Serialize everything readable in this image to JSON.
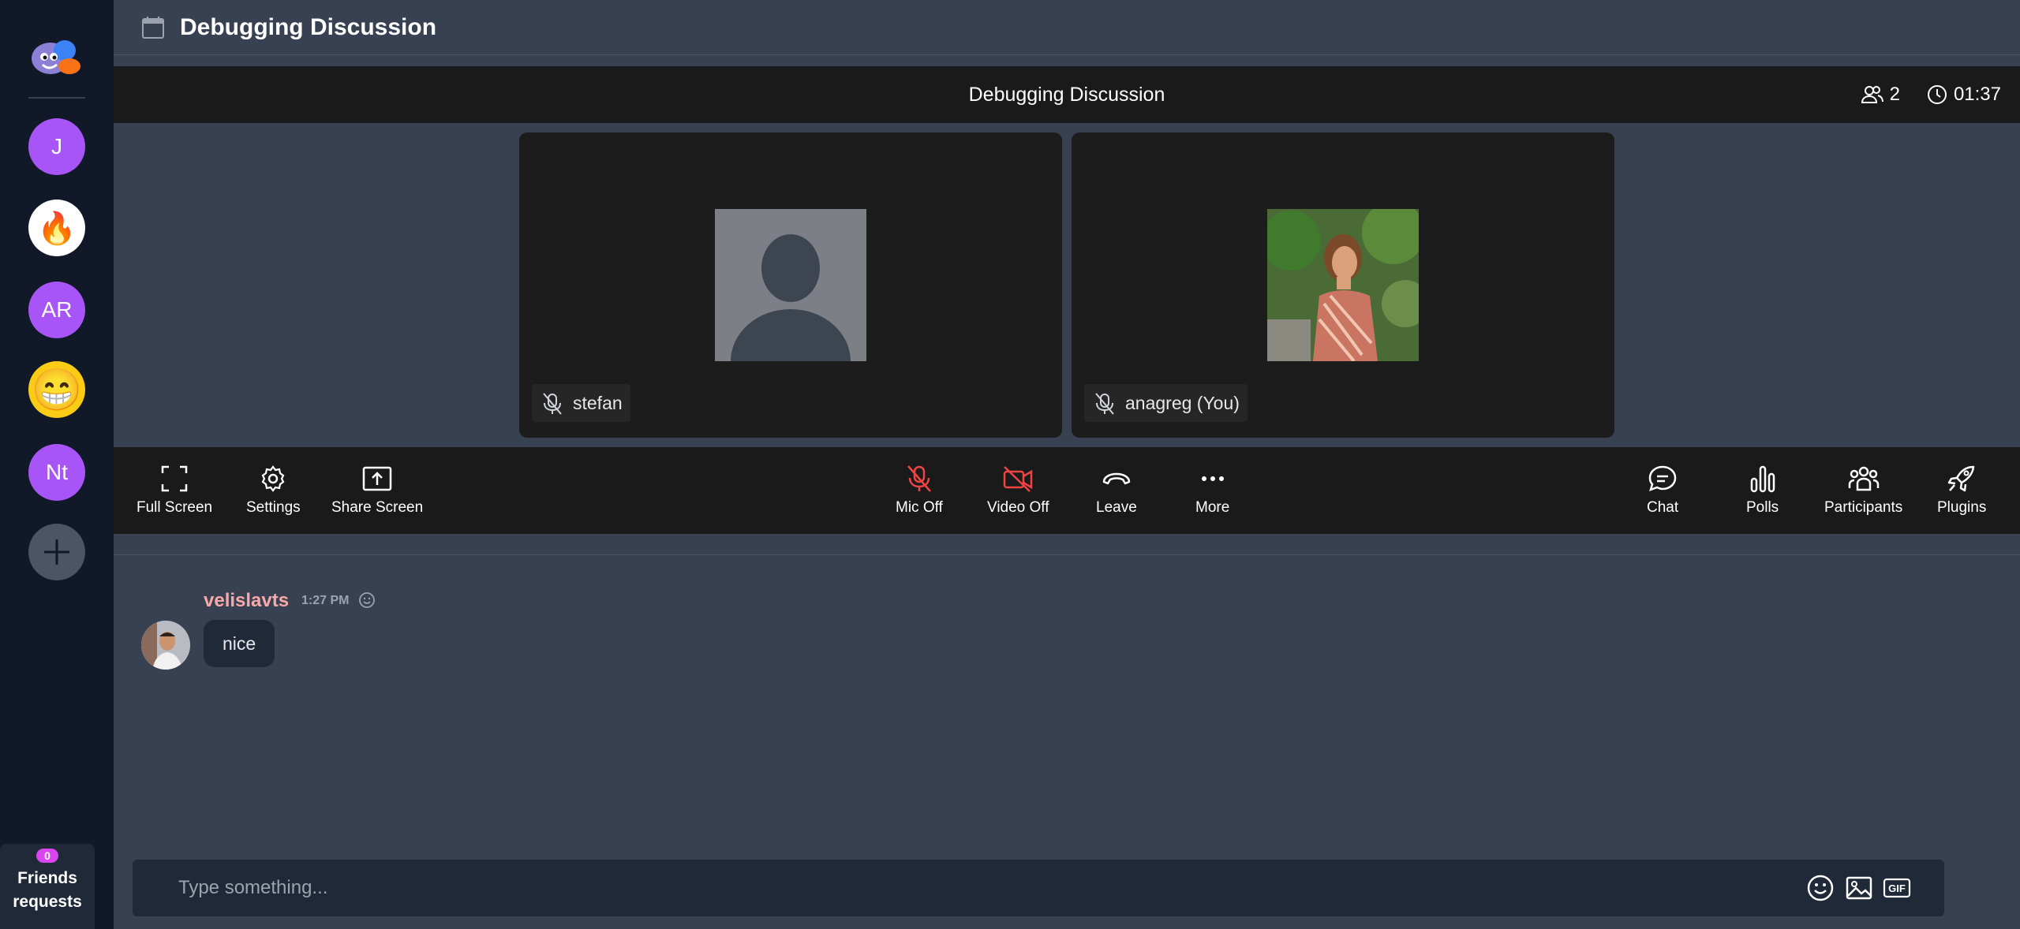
{
  "rail": {
    "servers": [
      {
        "label": "J"
      },
      {
        "label": "🔥"
      },
      {
        "label": "AR"
      },
      {
        "label": "😁"
      },
      {
        "label": "Nt"
      }
    ],
    "friends_count": "0",
    "friends_label_1": "Friends",
    "friends_label_2": "requests"
  },
  "header": {
    "title": "Debugging Discussion"
  },
  "call": {
    "title": "Debugging Discussion",
    "participants_count": "2",
    "duration": "01:37"
  },
  "tiles": [
    {
      "name": "stefan"
    },
    {
      "name": "anagreg (You)"
    }
  ],
  "controls": {
    "fullscreen": "Full Screen",
    "settings": "Settings",
    "share": "Share Screen",
    "mic": "Mic Off",
    "video": "Video Off",
    "leave": "Leave",
    "more": "More",
    "chat": "Chat",
    "polls": "Polls",
    "participants": "Participants",
    "plugins": "Plugins"
  },
  "message": {
    "author": "velislavts",
    "time": "1:27 PM",
    "text": "nice"
  },
  "composer": {
    "placeholder": "Type something..."
  },
  "colors": {
    "accent_purple": "#a855f7",
    "danger": "#ef4444",
    "author": "#f9a8a8"
  }
}
